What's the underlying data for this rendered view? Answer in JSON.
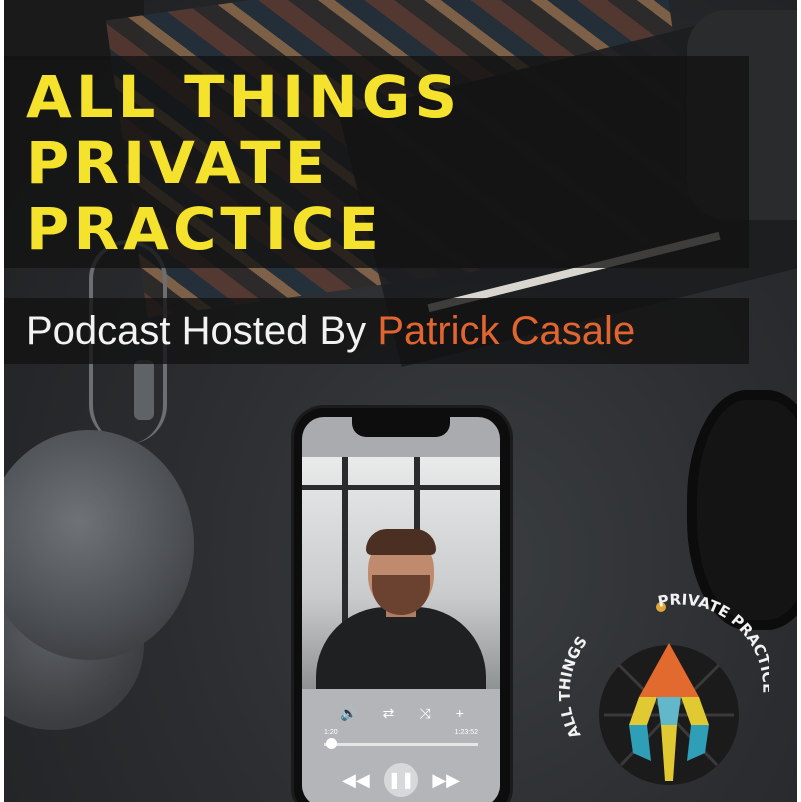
{
  "cover": {
    "title_lines": [
      "ALL THINGS",
      "PRIVATE",
      "PRACTICE"
    ],
    "subtitle_prefix": "Podcast Hosted By",
    "subtitle_host": "Patrick Casale"
  },
  "player": {
    "controls": {
      "volume_icon": "speaker-icon",
      "repeat_icon": "repeat-icon",
      "shuffle_icon": "shuffle-icon",
      "add_icon": "plus-icon"
    },
    "time_elapsed": "1:20",
    "time_total": "1:23:52",
    "progress_fraction": 0.05,
    "rewind_icon": "rewind-icon",
    "pause_icon": "pause-icon",
    "forward_icon": "forward-icon"
  },
  "logo": {
    "arc_text_left": "ALL THINGS",
    "arc_text_right": "PRIVATE PRACTICE"
  },
  "colors": {
    "title_yellow": "#f4e22d",
    "host_orange": "#e2652f",
    "subtitle_white": "#f2f2f2"
  }
}
